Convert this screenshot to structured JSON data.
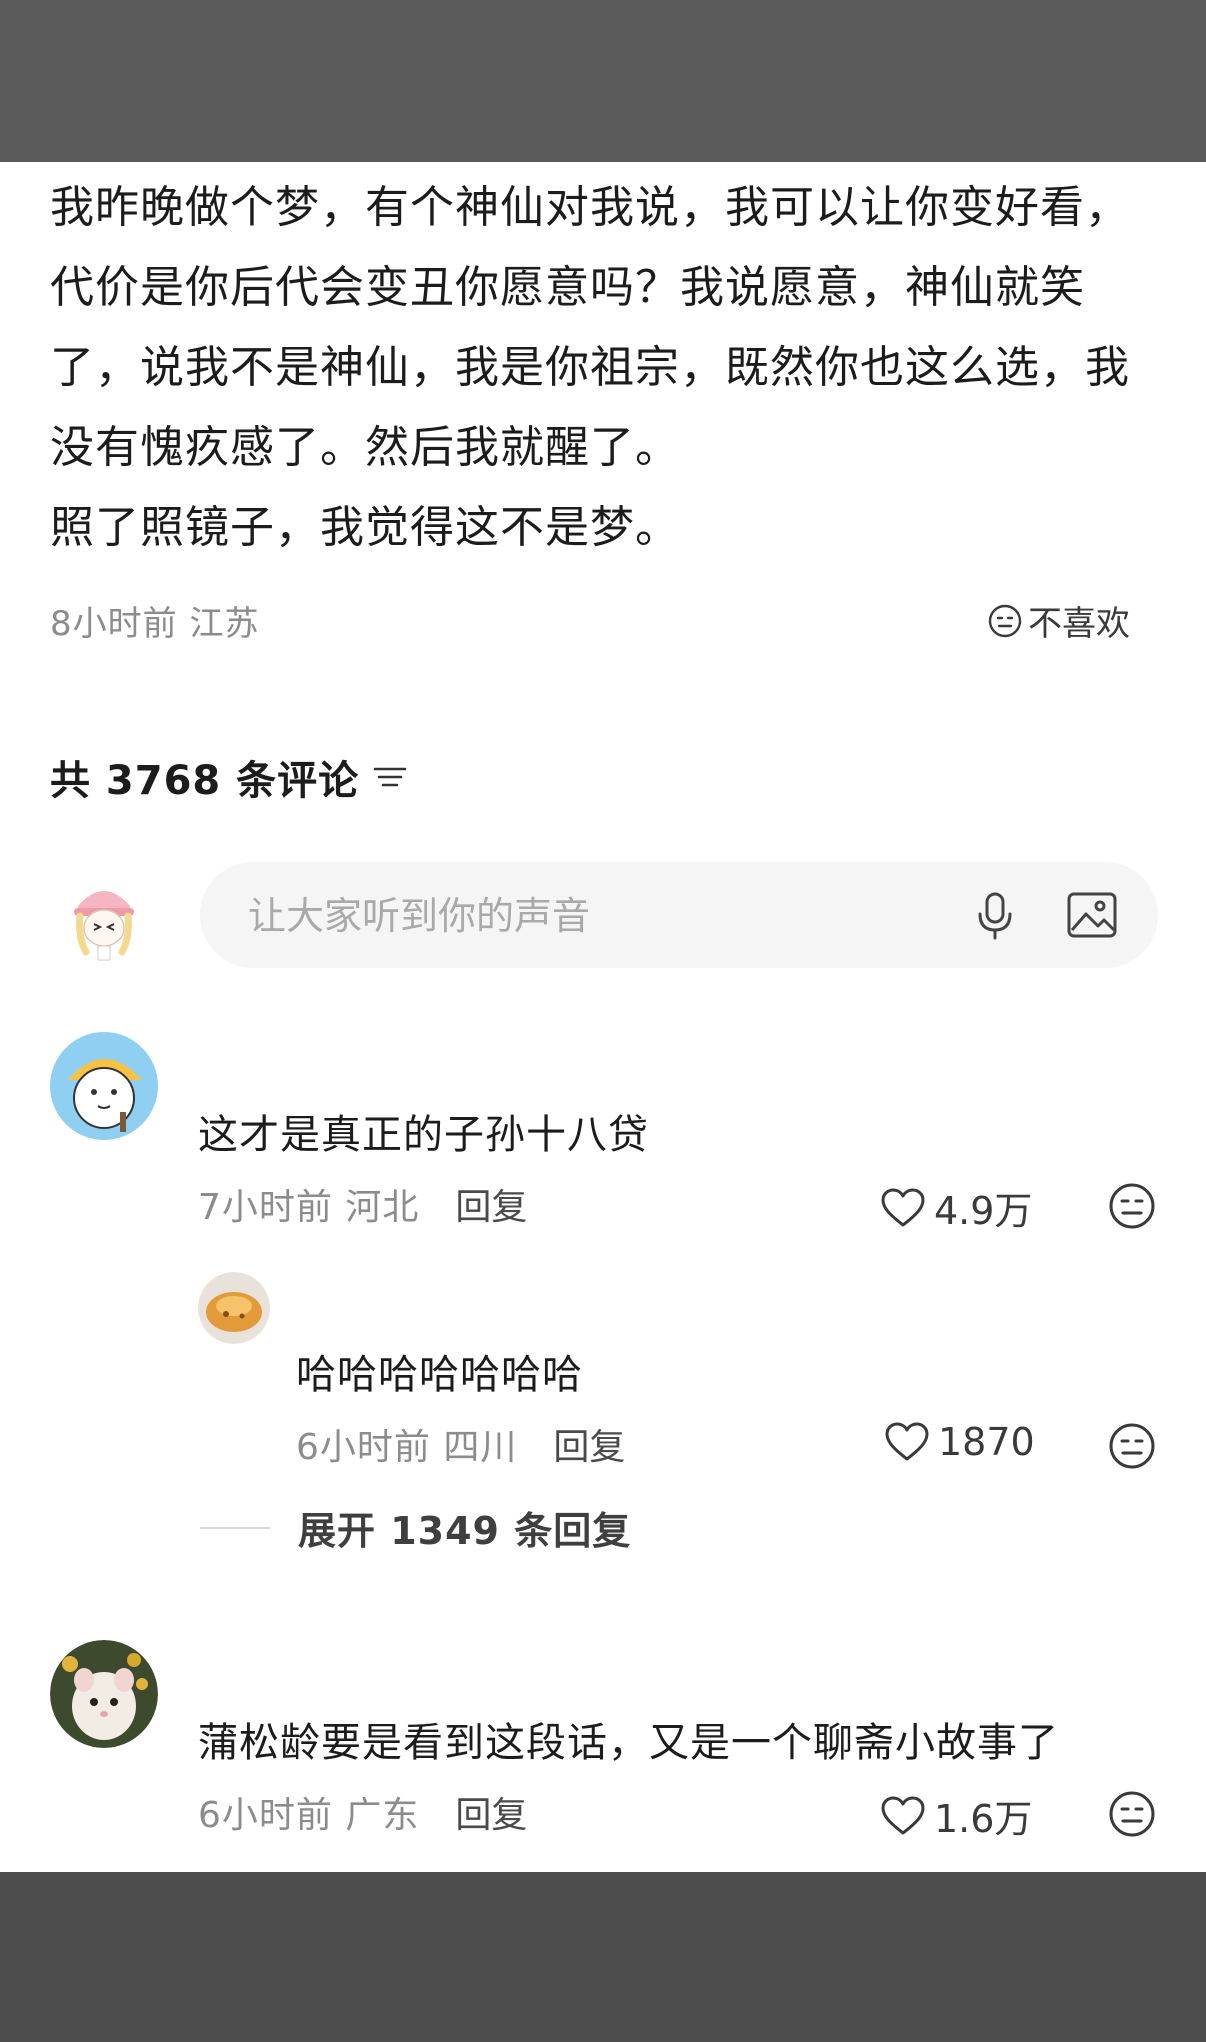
{
  "post": {
    "body": "我昨晚做个梦，有个神仙对我说，我可以让你变好看，代价是你后代会变丑你愿意吗？我说愿意，神仙就笑了，说我不是神仙，我是你祖宗，既然你也这么选，我没有愧疚感了。然后我就醒了。\n照了照镜子，我觉得这不是梦。",
    "time": "8小时前",
    "location": "江苏",
    "dislike_label": "不喜欢"
  },
  "comments_section": {
    "count_label": "共 3768 条评论",
    "sort_icon": "sort-icon"
  },
  "composer": {
    "placeholder": "让大家听到你的声音",
    "mic_icon": "microphone-icon",
    "image_icon": "image-icon"
  },
  "comments": [
    {
      "text": "这才是真正的子孙十八贷",
      "time": "7小时前",
      "location": "河北",
      "reply_label": "回复",
      "likes": "4.9万"
    },
    {
      "text": "蒲松龄要是看到这段话，又是一个聊斋小故事了",
      "time": "6小时前",
      "location": "广东",
      "reply_label": "回复",
      "likes": "1.6万"
    }
  ],
  "reply": {
    "text": "哈哈哈哈哈哈哈",
    "time": "6小时前",
    "location": "四川",
    "reply_label": "回复",
    "likes": "1870"
  },
  "expand_replies_label": "展开 1349 条回复",
  "colors": {
    "top_bar": "#5a5a5a",
    "bottom_bar": "#4d4d4d",
    "meta_gray": "#8c8c8c",
    "composer_bg": "#f5f5f5"
  }
}
